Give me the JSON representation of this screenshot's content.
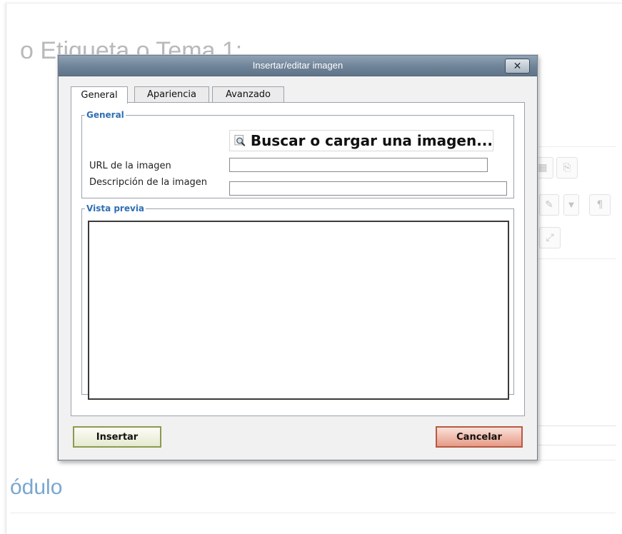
{
  "background": {
    "heading": "o Etiqueta o Tema 1:",
    "module_label": "ódulo",
    "toolbar_icons": [
      "table-icon",
      "paste-icon",
      "edit-icon",
      "dropdown-arrow-icon",
      "paragraph-direction-icon",
      "fullscreen-icon"
    ]
  },
  "dialog": {
    "title": "Insertar/editar imagen",
    "close_label": "✕",
    "tabs": [
      {
        "label": "General",
        "active": true
      },
      {
        "label": "Apariencia",
        "active": false
      },
      {
        "label": "Avanzado",
        "active": false
      }
    ],
    "general": {
      "legend": "General",
      "browse_label": "Buscar o cargar una imagen...",
      "browse_icon": "magnifier-image-icon",
      "url_label": "URL de la imagen",
      "url_value": "",
      "description_label": "Descripción de la imagen",
      "description_value": ""
    },
    "preview": {
      "legend": "Vista previa"
    },
    "insert_label": "Insertar",
    "cancel_label": "Cancelar"
  },
  "colors": {
    "titlebar": "#6f8398",
    "legend": "#2f6fb4",
    "insert_border": "#8c9a4f",
    "cancel_fill": "#e69a85"
  }
}
